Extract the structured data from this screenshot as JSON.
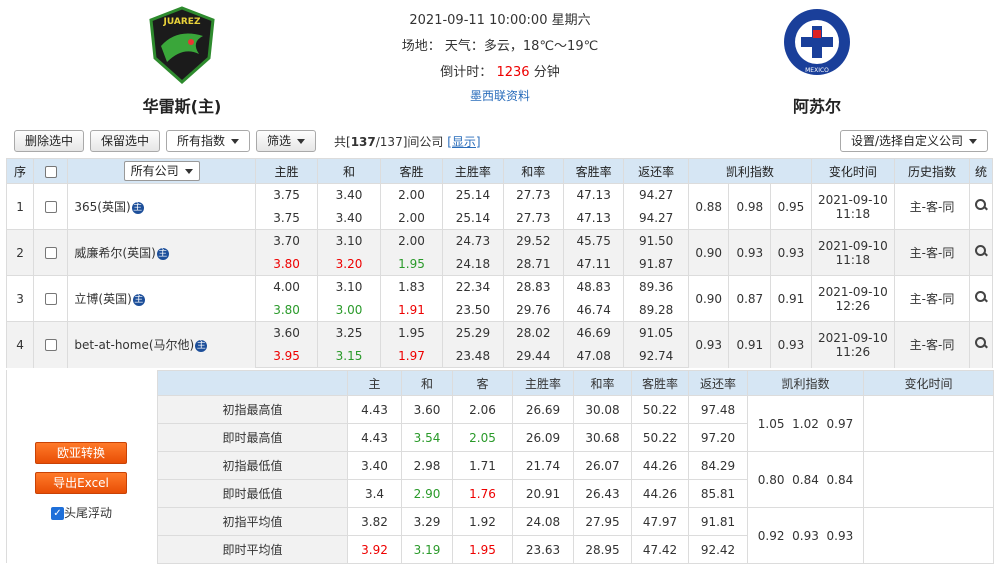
{
  "header": {
    "home_team": "华雷斯(主)",
    "away_team": "阿苏尔",
    "datetime": "2021-09-11 10:00:00 星期六",
    "venue": "场地： 天气：多云，18℃～19℃",
    "countdown_label": "倒计时：",
    "countdown_value": "1236",
    "countdown_unit": "分钟",
    "league_link": "墨西联资料"
  },
  "toolbar": {
    "delete_selected": "删除选中",
    "keep_selected": "保留选中",
    "all_indices": "所有指数",
    "filter": "筛选",
    "count_prefix": "共[",
    "count_a": "137",
    "count_sep": "/137]间公司",
    "show_link": "[显示]",
    "custom_company": "设置/选择自定义公司"
  },
  "table": {
    "headers": {
      "seq": "序",
      "all_companies": "所有公司",
      "home_win": "主胜",
      "draw": "和",
      "away_win": "客胜",
      "home_rate": "主胜率",
      "draw_rate": "和率",
      "away_rate": "客胜率",
      "return_rate": "返还率",
      "kelly": "凯利指数",
      "change_time": "变化时间",
      "history": "历史指数",
      "stats": "统"
    },
    "rows": [
      {
        "seq": "1",
        "company": "365(英国)",
        "host": "主",
        "top": [
          "3.75",
          "3.40",
          "2.00",
          "25.14",
          "27.73",
          "47.13",
          "94.27"
        ],
        "bot": [
          "3.75",
          "3.40",
          "2.00",
          "25.14",
          "27.73",
          "47.13",
          "94.27"
        ],
        "kelly": [
          "0.88",
          "0.98",
          "0.95"
        ],
        "date": "2021-09-10",
        "time": "11:18",
        "history": "主-客-同"
      },
      {
        "seq": "2",
        "company": "威廉希尔(英国)",
        "host": "主",
        "top": [
          "3.70",
          "3.10",
          "2.00",
          "24.73",
          "29.52",
          "45.75",
          "91.50"
        ],
        "bot": [
          "3.80",
          "3.20",
          "1.95",
          "24.18",
          "28.71",
          "47.11",
          "91.87"
        ],
        "kelly": [
          "0.90",
          "0.93",
          "0.93"
        ],
        "date": "2021-09-10",
        "time": "11:18",
        "history": "主-客-同"
      },
      {
        "seq": "3",
        "company": "立博(英国)",
        "host": "主",
        "top": [
          "4.00",
          "3.10",
          "1.83",
          "22.34",
          "28.83",
          "48.83",
          "89.36"
        ],
        "bot": [
          "3.80",
          "3.00",
          "1.91",
          "23.50",
          "29.76",
          "46.74",
          "89.28"
        ],
        "kelly": [
          "0.90",
          "0.87",
          "0.91"
        ],
        "date": "2021-09-10",
        "time": "12:26",
        "history": "主-客-同"
      },
      {
        "seq": "4",
        "company": "bet-at-home(马尔他)",
        "host": "主",
        "top": [
          "3.60",
          "3.25",
          "1.95",
          "25.29",
          "28.02",
          "46.69",
          "91.05"
        ],
        "bot": [
          "3.95",
          "3.15",
          "1.97",
          "23.48",
          "29.44",
          "47.08",
          "92.74"
        ],
        "kelly": [
          "0.93",
          "0.91",
          "0.93"
        ],
        "date": "2021-09-10",
        "time": "11:26",
        "history": "主-客-同"
      }
    ]
  },
  "summary": {
    "euro_asia_button": "欧亚转换",
    "export_button": "导出Excel",
    "float_label": "头尾浮动",
    "headers": [
      "主",
      "和",
      "客",
      "主胜率",
      "和率",
      "客胜率",
      "返还率",
      "凯利指数",
      "变化时间"
    ],
    "rows": [
      {
        "label": "初指最高值",
        "vals": [
          "4.43",
          "3.60",
          "2.06",
          "26.69",
          "30.08",
          "50.22",
          "97.48"
        ]
      },
      {
        "label": "即时最高值",
        "vals": [
          "4.43",
          "3.54",
          "2.05",
          "26.09",
          "30.68",
          "50.22",
          "97.20"
        ]
      },
      {
        "label": "初指最低值",
        "vals": [
          "3.40",
          "2.98",
          "1.71",
          "21.74",
          "26.07",
          "44.26",
          "84.29"
        ]
      },
      {
        "label": "即时最低值",
        "vals": [
          "3.4",
          "2.90",
          "1.76",
          "20.91",
          "26.43",
          "44.26",
          "85.81"
        ]
      },
      {
        "label": "初指平均值",
        "vals": [
          "3.82",
          "3.29",
          "1.92",
          "24.08",
          "27.95",
          "47.97",
          "91.81"
        ]
      },
      {
        "label": "即时平均值",
        "vals": [
          "3.92",
          "3.19",
          "1.95",
          "23.63",
          "28.95",
          "47.42",
          "92.42"
        ]
      }
    ],
    "kelly": [
      [
        "1.05",
        "1.02",
        "0.97"
      ],
      [
        "0.80",
        "0.84",
        "0.84"
      ],
      [
        "0.92",
        "0.93",
        "0.93"
      ]
    ]
  },
  "colors": {
    "up": "#e00000",
    "down": "#2a9a2a",
    "header_bg": "#d6e6f4",
    "button_orange": "#f06010"
  }
}
